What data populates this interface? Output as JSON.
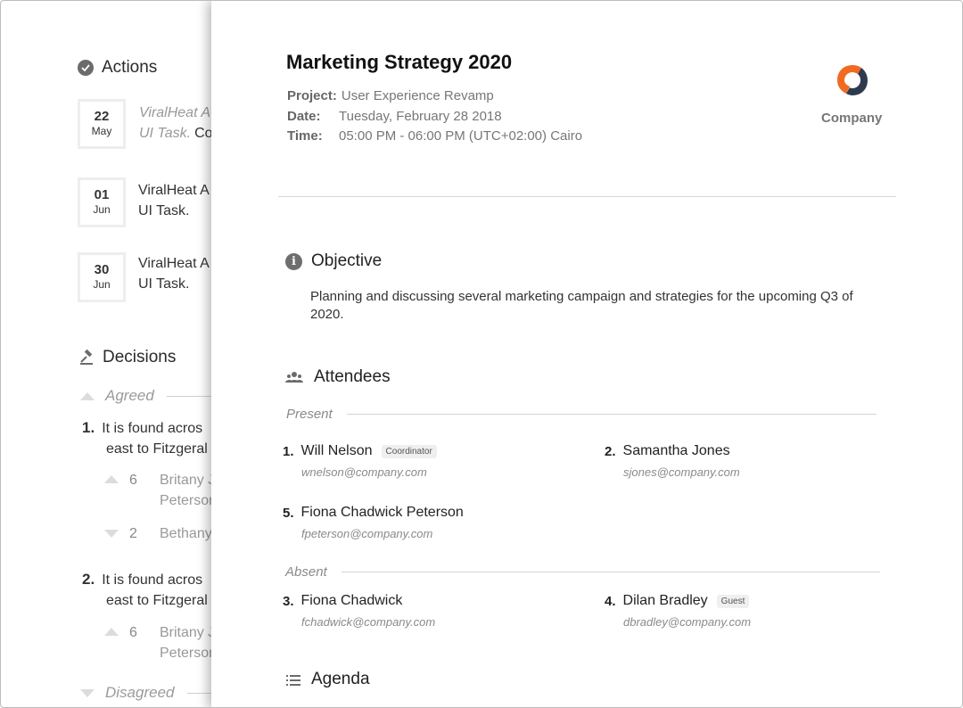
{
  "background_doc": {
    "actions_title": "Actions",
    "actions": [
      {
        "day": "22",
        "month": "May",
        "line1": "ViralHeat A",
        "line2": "UI Task.",
        "line2_tail": "Co",
        "faded": true
      },
      {
        "day": "01",
        "month": "Jun",
        "line1": "ViralHeat A",
        "line2": "UI Task.",
        "line2_tail": "",
        "faded": false
      },
      {
        "day": "30",
        "month": "Jun",
        "line1": "ViralHeat A",
        "line2": "UI Task.",
        "line2_tail": "",
        "faded": false
      }
    ],
    "decisions_title": "Decisions",
    "agreed_label": "Agreed",
    "disagreed_label": "Disagreed",
    "decisions": [
      {
        "number": "1.",
        "line1": "It is found acros",
        "line2": "east to Fitzgeral",
        "votes": [
          {
            "count": "6",
            "direction": "up",
            "line1": "Britany J",
            "line2": "Peterson"
          },
          {
            "count": "2",
            "direction": "down",
            "line1": "Bethany",
            "line2": ""
          }
        ]
      },
      {
        "number": "2.",
        "line1": "It is found acros",
        "line2": "east to Fitzgeral",
        "votes": [
          {
            "count": "6",
            "direction": "up",
            "line1": "Britany J",
            "line2": "Peterson"
          }
        ]
      }
    ]
  },
  "meeting": {
    "title": "Marketing Strategy 2020",
    "project_label": "Project:",
    "project": "User Experience Revamp",
    "date_label": "Date:",
    "date": "Tuesday, February 28 2018",
    "time_label": "Time:",
    "time": "05:00 PM - 06:00 PM (UTC+02:00) Cairo",
    "company": "Company",
    "logo_icon": "company-logo",
    "brand_colors": {
      "orange": "#f26a21",
      "navy": "#2f3a4f"
    }
  },
  "objective": {
    "title": "Objective",
    "text": "Planning and discussing several marketing campaign and strategies for the upcoming Q3 of 2020."
  },
  "attendees": {
    "title": "Attendees",
    "present_label": "Present",
    "absent_label": "Absent",
    "present": [
      {
        "number": "1.",
        "name": "Will Nelson",
        "badge": "Coordinator",
        "email": "wnelson@company.com"
      },
      {
        "number": "2.",
        "name": "Samantha Jones",
        "badge": "",
        "email": "sjones@company.com"
      },
      {
        "number": "5.",
        "name": "Fiona Chadwick Peterson",
        "badge": "",
        "email": "fpeterson@company.com"
      }
    ],
    "absent": [
      {
        "number": "3.",
        "name": "Fiona Chadwick",
        "badge": "",
        "email": "fchadwick@company.com"
      },
      {
        "number": "4.",
        "name": "Dilan Bradley",
        "badge": "Guest",
        "email": "dbradley@company.com"
      }
    ]
  },
  "agenda": {
    "title": "Agenda"
  }
}
